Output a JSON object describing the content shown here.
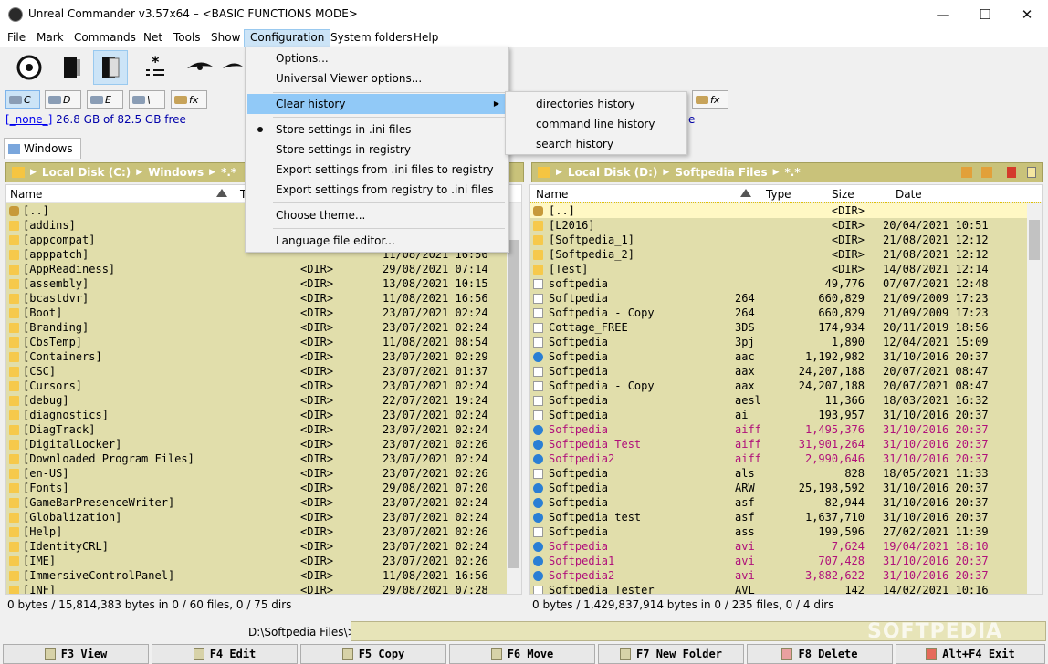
{
  "window": {
    "title": "Unreal Commander v3.57x64 – <BASIC FUNCTIONS MODE>",
    "minimize": "—",
    "maximize": "☐",
    "close": "✕"
  },
  "menu": [
    "File",
    "Mark",
    "Commands",
    "Net",
    "Tools",
    "Show",
    "Configuration",
    "System folders",
    "Help"
  ],
  "config_menu": {
    "items": [
      {
        "label": "Options..."
      },
      {
        "label": "Universal Viewer options..."
      },
      {
        "label": "Clear history"
      },
      {
        "label": "Store settings in .ini files"
      },
      {
        "label": "Store settings in registry"
      },
      {
        "label": "Export settings from .ini files to registry"
      },
      {
        "label": "Export settings from registry to .ini files"
      },
      {
        "label": "Choose theme..."
      },
      {
        "label": "Language file editor..."
      }
    ],
    "submenu_arrow": "▶"
  },
  "clear_history_submenu": [
    "directories history",
    "command line history",
    "search history"
  ],
  "drives": {
    "left": [
      "C",
      "D",
      "E",
      "\\",
      "fx"
    ],
    "right_partial": [
      "fx"
    ]
  },
  "left_free": {
    "label": "[_none_]",
    "text": "26.8 GB of 82.5 GB free"
  },
  "right_free_partial": "e",
  "left_tab": "Windows",
  "left_path": {
    "drive": "Local Disk (C:)",
    "folder": "Windows",
    "filter": "*.*"
  },
  "right_path": {
    "drive": "Local Disk (D:)",
    "folder": "Softpedia Files",
    "filter": "*.*"
  },
  "columns": {
    "name": "Name",
    "type": "Type",
    "size": "Size",
    "date": "Date",
    "type_partial": "T"
  },
  "left_rows": [
    {
      "name": "[..]",
      "size": "",
      "date": ""
    },
    {
      "name": "[addins]",
      "size": "",
      "date": ""
    },
    {
      "name": "[appcompat]",
      "size": "",
      "date": ""
    },
    {
      "name": "[apppatch]",
      "size": "",
      "date": "11/08/2021 16:56"
    },
    {
      "name": "[AppReadiness]",
      "size": "<DIR>",
      "date": "29/08/2021 07:14"
    },
    {
      "name": "[assembly]",
      "size": "<DIR>",
      "date": "13/08/2021 10:15"
    },
    {
      "name": "[bcastdvr]",
      "size": "<DIR>",
      "date": "11/08/2021 16:56"
    },
    {
      "name": "[Boot]",
      "size": "<DIR>",
      "date": "23/07/2021 02:24"
    },
    {
      "name": "[Branding]",
      "size": "<DIR>",
      "date": "23/07/2021 02:24"
    },
    {
      "name": "[CbsTemp]",
      "size": "<DIR>",
      "date": "11/08/2021 08:54"
    },
    {
      "name": "[Containers]",
      "size": "<DIR>",
      "date": "23/07/2021 02:29"
    },
    {
      "name": "[CSC]",
      "size": "<DIR>",
      "date": "23/07/2021 01:37"
    },
    {
      "name": "[Cursors]",
      "size": "<DIR>",
      "date": "23/07/2021 02:24"
    },
    {
      "name": "[debug]",
      "size": "<DIR>",
      "date": "22/07/2021 19:24"
    },
    {
      "name": "[diagnostics]",
      "size": "<DIR>",
      "date": "23/07/2021 02:24"
    },
    {
      "name": "[DiagTrack]",
      "size": "<DIR>",
      "date": "23/07/2021 02:24"
    },
    {
      "name": "[DigitalLocker]",
      "size": "<DIR>",
      "date": "23/07/2021 02:26"
    },
    {
      "name": "[Downloaded Program Files]",
      "size": "<DIR>",
      "date": "23/07/2021 02:24"
    },
    {
      "name": "[en-US]",
      "size": "<DIR>",
      "date": "23/07/2021 02:26"
    },
    {
      "name": "[Fonts]",
      "size": "<DIR>",
      "date": "29/08/2021 07:20"
    },
    {
      "name": "[GameBarPresenceWriter]",
      "size": "<DIR>",
      "date": "23/07/2021 02:24"
    },
    {
      "name": "[Globalization]",
      "size": "<DIR>",
      "date": "23/07/2021 02:24"
    },
    {
      "name": "[Help]",
      "size": "<DIR>",
      "date": "23/07/2021 02:26"
    },
    {
      "name": "[IdentityCRL]",
      "size": "<DIR>",
      "date": "23/07/2021 02:24"
    },
    {
      "name": "[IME]",
      "size": "<DIR>",
      "date": "23/07/2021 02:26"
    },
    {
      "name": "[ImmersiveControlPanel]",
      "size": "<DIR>",
      "date": "11/08/2021 16:56"
    },
    {
      "name": "[INF]",
      "size": "<DIR>",
      "date": "29/08/2021 07:28"
    }
  ],
  "right_rows": [
    {
      "name": "[..]",
      "type": "",
      "size": "<DIR>",
      "date": "",
      "icon": "up",
      "pink": false
    },
    {
      "name": "[L2016]",
      "type": "",
      "size": "<DIR>",
      "date": "20/04/2021 10:51",
      "icon": "fold",
      "pink": false
    },
    {
      "name": "[Softpedia_1]",
      "type": "",
      "size": "<DIR>",
      "date": "21/08/2021 12:12",
      "icon": "fold",
      "pink": false
    },
    {
      "name": "[Softpedia_2]",
      "type": "",
      "size": "<DIR>",
      "date": "21/08/2021 12:12",
      "icon": "fold",
      "pink": false
    },
    {
      "name": "[Test]",
      "type": "",
      "size": "<DIR>",
      "date": "14/08/2021 12:14",
      "icon": "fold",
      "pink": false
    },
    {
      "name": "softpedia",
      "type": "",
      "size": "49,776",
      "date": "07/07/2021 12:48",
      "icon": "file",
      "pink": false
    },
    {
      "name": "Softpedia",
      "type": "264",
      "size": "660,829",
      "date": "21/09/2009 17:23",
      "icon": "file",
      "pink": false
    },
    {
      "name": "Softpedia - Copy",
      "type": "264",
      "size": "660,829",
      "date": "21/09/2009 17:23",
      "icon": "file",
      "pink": false
    },
    {
      "name": "Cottage_FREE",
      "type": "3DS",
      "size": "174,934",
      "date": "20/11/2019 18:56",
      "icon": "file",
      "pink": false
    },
    {
      "name": "Softpedia",
      "type": "3pj",
      "size": "1,890",
      "date": "12/04/2021 15:09",
      "icon": "file",
      "pink": false
    },
    {
      "name": "Softpedia",
      "type": "aac",
      "size": "1,192,982",
      "date": "31/10/2016 20:37",
      "icon": "media",
      "pink": false
    },
    {
      "name": "Softpedia",
      "type": "aax",
      "size": "24,207,188",
      "date": "20/07/2021 08:47",
      "icon": "file",
      "pink": false
    },
    {
      "name": "Softpedia - Copy",
      "type": "aax",
      "size": "24,207,188",
      "date": "20/07/2021 08:47",
      "icon": "file",
      "pink": false
    },
    {
      "name": "Softpedia",
      "type": "aesl",
      "size": "11,366",
      "date": "18/03/2021 16:32",
      "icon": "file",
      "pink": false
    },
    {
      "name": "Softpedia",
      "type": "ai",
      "size": "193,957",
      "date": "31/10/2016 20:37",
      "icon": "file",
      "pink": false
    },
    {
      "name": "Softpedia",
      "type": "aiff",
      "size": "1,495,376",
      "date": "31/10/2016 20:37",
      "icon": "media",
      "pink": true
    },
    {
      "name": "Softpedia Test",
      "type": "aiff",
      "size": "31,901,264",
      "date": "31/10/2016 20:37",
      "icon": "media",
      "pink": true
    },
    {
      "name": "Softpedia2",
      "type": "aiff",
      "size": "2,990,646",
      "date": "31/10/2016 20:37",
      "icon": "media",
      "pink": true
    },
    {
      "name": "Softpedia",
      "type": "als",
      "size": "828",
      "date": "18/05/2021 11:33",
      "icon": "file",
      "pink": false
    },
    {
      "name": "Softpedia",
      "type": "ARW",
      "size": "25,198,592",
      "date": "31/10/2016 20:37",
      "icon": "media",
      "pink": false
    },
    {
      "name": "Softpedia",
      "type": "asf",
      "size": "82,944",
      "date": "31/10/2016 20:37",
      "icon": "media",
      "pink": false
    },
    {
      "name": "Softpedia test",
      "type": "asf",
      "size": "1,637,710",
      "date": "31/10/2016 20:37",
      "icon": "media",
      "pink": false
    },
    {
      "name": "Softpedia",
      "type": "ass",
      "size": "199,596",
      "date": "27/02/2021 11:39",
      "icon": "file",
      "pink": false
    },
    {
      "name": "Softpedia",
      "type": "avi",
      "size": "7,624",
      "date": "19/04/2021 18:10",
      "icon": "media",
      "pink": true
    },
    {
      "name": "Softpedia1",
      "type": "avi",
      "size": "707,428",
      "date": "31/10/2016 20:37",
      "icon": "media",
      "pink": true
    },
    {
      "name": "Softpedia2",
      "type": "avi",
      "size": "3,882,622",
      "date": "31/10/2016 20:37",
      "icon": "media",
      "pink": true
    },
    {
      "name": "Softpedia Tester",
      "type": "AVL",
      "size": "142",
      "date": "14/02/2021 10:16",
      "icon": "file",
      "pink": false
    }
  ],
  "left_status": "0 bytes / 15,814,383 bytes in 0 / 60 files, 0 / 75 dirs",
  "right_status": "0 bytes / 1,429,837,914 bytes in 0 / 235 files, 0 / 4 dirs",
  "cmdline": {
    "path": "D:\\Softpedia Files\\>",
    "value": ""
  },
  "fkeys": [
    "F3 View",
    "F4 Edit",
    "F5 Copy",
    "F6 Move",
    "F7 New Folder",
    "F8 Delete",
    "Alt+F4 Exit"
  ],
  "watermark": "SOFTPEDIA",
  "colors": {
    "olive_row": "#e1deab",
    "path_bar": "#c9c27a",
    "pink_text": "#b0107a",
    "menu_highlight": "#91c9f7"
  }
}
